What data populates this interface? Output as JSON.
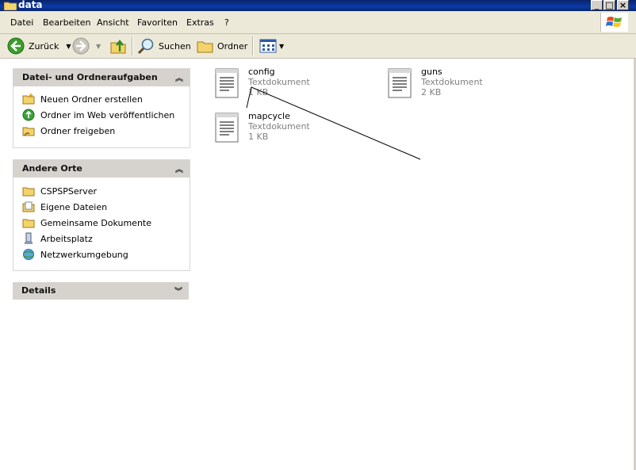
{
  "window": {
    "title": "data"
  },
  "menu": [
    "Datei",
    "Bearbeiten",
    "Ansicht",
    "Favoriten",
    "Extras",
    "?"
  ],
  "toolbar": {
    "back_label": "Zurück",
    "search_label": "Suchen",
    "folders_label": "Ordner"
  },
  "tasks_box": {
    "title": "Datei- und Ordneraufgaben",
    "items": [
      {
        "label": "Neuen Ordner erstellen",
        "icon": "new-folder-icon"
      },
      {
        "label": "Ordner im Web veröffentlichen",
        "icon": "web-publish-icon"
      },
      {
        "label": "Ordner freigeben",
        "icon": "share-folder-icon"
      }
    ]
  },
  "places_box": {
    "title": "Andere Orte",
    "items": [
      {
        "label": "CSPSPServer",
        "icon": "folder-icon"
      },
      {
        "label": "Eigene Dateien",
        "icon": "my-documents-icon"
      },
      {
        "label": "Gemeinsame Dokumente",
        "icon": "folder-icon"
      },
      {
        "label": "Arbeitsplatz",
        "icon": "my-computer-icon"
      },
      {
        "label": "Netzwerkumgebung",
        "icon": "network-icon"
      }
    ]
  },
  "details_box": {
    "title": "Details"
  },
  "files": [
    {
      "name": "config",
      "type": "Textdokument",
      "size": "1 KB"
    },
    {
      "name": "guns",
      "type": "Textdokument",
      "size": "2 KB"
    },
    {
      "name": "mapcycle",
      "type": "Textdokument",
      "size": "1 KB"
    }
  ]
}
